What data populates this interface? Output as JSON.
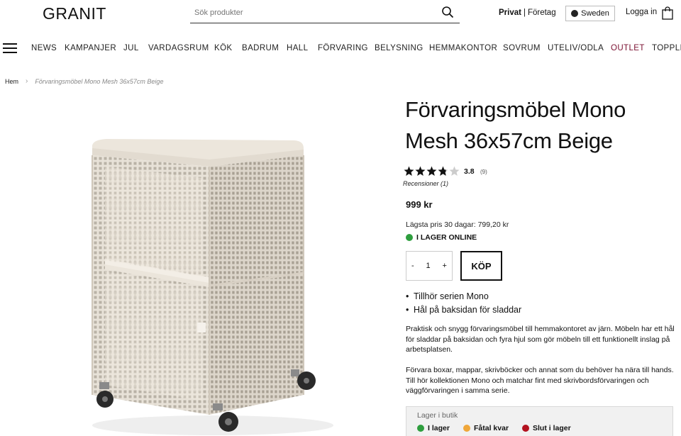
{
  "header": {
    "logo": "GRANIT",
    "search_placeholder": "Sök produkter",
    "segment_privat": "Privat",
    "segment_sep": "|",
    "segment_foretag": "Företag",
    "country": "Sweden",
    "login": "Logga in"
  },
  "nav": {
    "items": [
      "NEWS",
      "KAMPANJER",
      "JUL",
      "VARDAGSRUM",
      "KÖK",
      "BADRUM",
      "HALL",
      "FÖRVARING",
      "BELYSNING",
      "HEMMAKONTOR",
      "SOVRUM",
      "UTELIV/ODLA",
      "OUTLET",
      "TOPPLIS"
    ]
  },
  "breadcrumb": {
    "home": "Hem",
    "current": "Förvaringsmöbel Mono Mesh 36x57cm Beige"
  },
  "product": {
    "title": "Förvaringsmöbel Mono Mesh 36x57cm Beige",
    "rating": 3.8,
    "rating_text": "3.8",
    "rating_count": "(9)",
    "reviews": "Recensioner (1)",
    "price": "999 kr",
    "lowest_price": "Lägsta pris 30 dagar: 799,20 kr",
    "stock_online": "I LAGER ONLINE",
    "qty_minus": "-",
    "qty_value": "1",
    "qty_plus": "+",
    "buy": "KÖP",
    "bullets": [
      "Tillhör serien Mono",
      "Hål på baksidan för sladdar"
    ],
    "desc1": "Praktisk och snygg förvaringsmöbel till hemmakontoret av järn. Möbeln har ett hål för sladdar på baksidan och fyra hjul som gör möbeln till ett funktionellt inslag på arbetsplatsen.",
    "desc2": "Förvara boxar, mappar, skrivböcker och annat som du behöver ha nära till hands. Till hör kollektionen Mono och matchar fint med skrivbordsförvaringen och väggförvaringen i samma serie."
  },
  "stores": {
    "heading": "Lager i butik",
    "in_stock": "I lager",
    "few_left": "Fåtal kvar",
    "sold_out": "Slut i lager"
  },
  "colors": {
    "green": "#2e9e3e",
    "orange": "#f0a73a",
    "red": "#b3121f",
    "outlet": "#7a1030",
    "product_beige": "#e9e3da"
  },
  "icons": {
    "search": "search-icon",
    "bag": "shopping-bag-icon",
    "menu": "hamburger-menu-icon",
    "globe": "globe-icon",
    "chevron": "chevron-right-icon",
    "star": "star-icon"
  }
}
